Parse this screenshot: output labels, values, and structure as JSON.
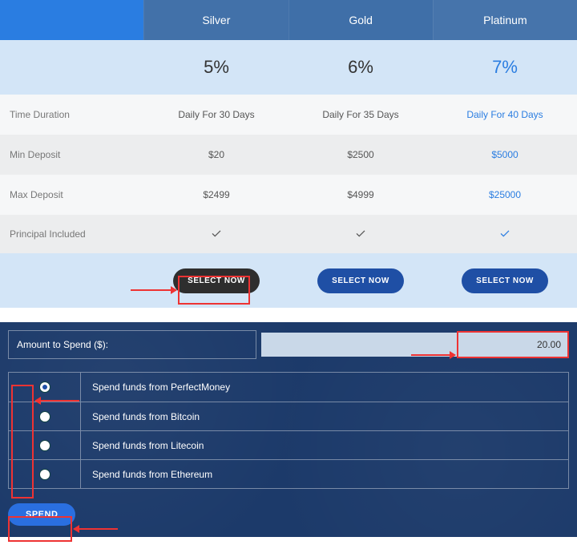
{
  "pricing": {
    "headers": {
      "blank": "",
      "silver": "Silver",
      "gold": "Gold",
      "platinum": "Platinum"
    },
    "percent": {
      "silver": "5%",
      "gold": "6%",
      "platinum": "7%"
    },
    "rows": {
      "duration": {
        "label": "Time Duration",
        "silver": "Daily For 30 Days",
        "gold": "Daily For 35 Days",
        "platinum": "Daily For 40 Days"
      },
      "min": {
        "label": "Min Deposit",
        "silver": "$20",
        "gold": "$2500",
        "platinum": "$5000"
      },
      "max": {
        "label": "Max Deposit",
        "silver": "$2499",
        "gold": "$4999",
        "platinum": "$25000"
      },
      "principal": {
        "label": "Principal Included"
      }
    },
    "select_label": "SELECT NOW"
  },
  "spend": {
    "amount_label": "Amount to Spend ($):",
    "amount_value": "20.00",
    "methods": [
      {
        "label": "Spend funds from PerfectMoney",
        "selected": true
      },
      {
        "label": "Spend funds from Bitcoin",
        "selected": false
      },
      {
        "label": "Spend funds from Litecoin",
        "selected": false
      },
      {
        "label": "Spend funds from Ethereum",
        "selected": false
      }
    ],
    "button": "SPEND"
  }
}
